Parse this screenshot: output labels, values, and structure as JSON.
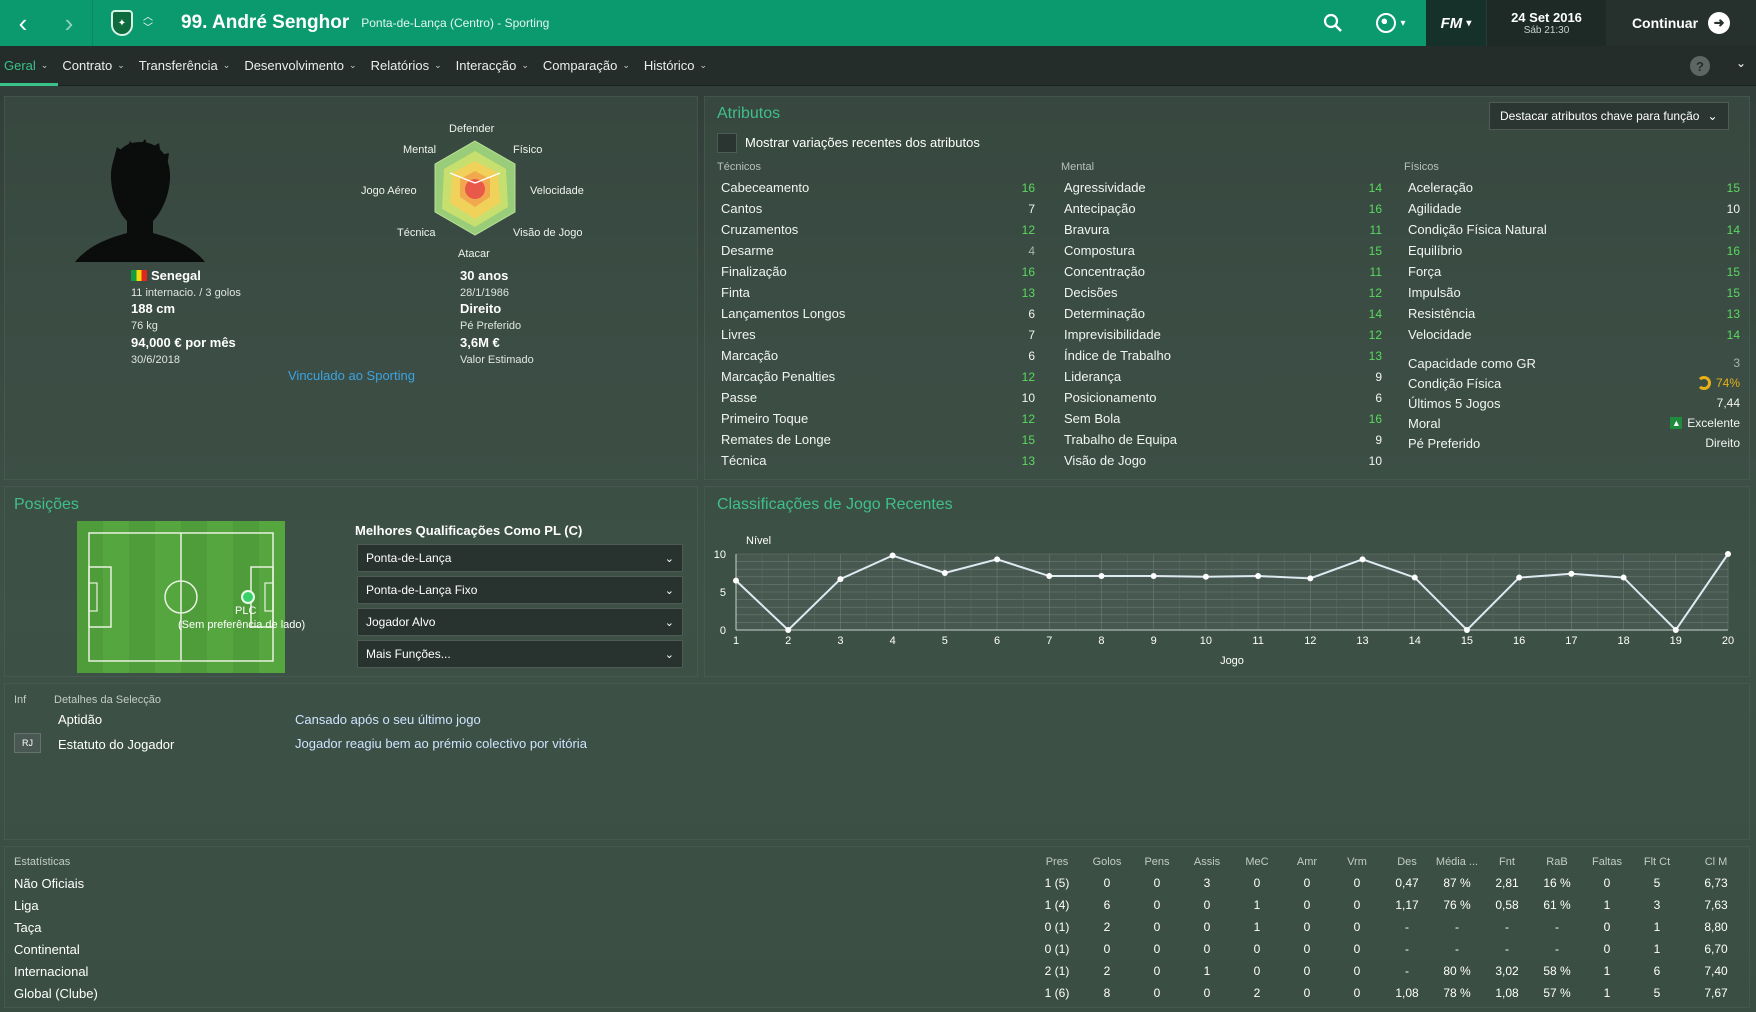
{
  "topbar": {
    "player_title": "99. André Senghor",
    "player_subtitle": "Ponta-de-Lança (Centro) - Sporting",
    "fm_label": "FM",
    "date_line1": "24 Set 2016",
    "date_line2": "Sáb 21:30",
    "continue_label": "Continuar"
  },
  "menu": {
    "items": [
      "Geral",
      "Contrato",
      "Transferência",
      "Desenvolvimento",
      "Relatórios",
      "Interacção",
      "Comparação",
      "Histórico"
    ],
    "active": "Geral",
    "help": "?"
  },
  "profile": {
    "nationality": "Senegal",
    "caps": "11 internacio. / 3 golos",
    "height": "188 cm",
    "weight": "76 kg",
    "wage": "94,000 € por mês",
    "contract_end": "30/6/2018",
    "age": "30 anos",
    "dob": "28/1/1986",
    "foot": "Direito",
    "foot_label": "Pé Preferido",
    "value": "3,6M €",
    "value_label": "Valor Estimado",
    "link": "Vinculado ao Sporting",
    "radar_labels": {
      "defender": "Defender",
      "fisico": "Físico",
      "velocidade": "Velocidade",
      "visao": "Visão de Jogo",
      "atacar": "Atacar",
      "tecnica": "Técnica",
      "jogo_aereo": "Jogo Aéreo",
      "mental": "Mental"
    }
  },
  "attributes": {
    "title": "Atributos",
    "highlight_dropdown": "Destacar atributos chave para função",
    "show_changes": "Mostrar variações recentes dos atributos",
    "tecnicos_label": "Técnicos",
    "mental_label": "Mental",
    "fisicos_label": "Físicos",
    "tecnicos": [
      {
        "name": "Cabeceamento",
        "value": "16",
        "tone": "green"
      },
      {
        "name": "Cantos",
        "value": "7",
        "tone": "white"
      },
      {
        "name": "Cruzamentos",
        "value": "12",
        "tone": "green"
      },
      {
        "name": "Desarme",
        "value": "4",
        "tone": "grey"
      },
      {
        "name": "Finalização",
        "value": "16",
        "tone": "green"
      },
      {
        "name": "Finta",
        "value": "13",
        "tone": "green"
      },
      {
        "name": "Lançamentos Longos",
        "value": "6",
        "tone": "white"
      },
      {
        "name": "Livres",
        "value": "7",
        "tone": "white"
      },
      {
        "name": "Marcação",
        "value": "6",
        "tone": "white"
      },
      {
        "name": "Marcação Penalties",
        "value": "12",
        "tone": "green"
      },
      {
        "name": "Passe",
        "value": "10",
        "tone": "white"
      },
      {
        "name": "Primeiro Toque",
        "value": "12",
        "tone": "green"
      },
      {
        "name": "Remates de Longe",
        "value": "15",
        "tone": "green"
      },
      {
        "name": "Técnica",
        "value": "13",
        "tone": "green"
      }
    ],
    "mental": [
      {
        "name": "Agressividade",
        "value": "14",
        "tone": "green"
      },
      {
        "name": "Antecipação",
        "value": "16",
        "tone": "green"
      },
      {
        "name": "Bravura",
        "value": "11",
        "tone": "green"
      },
      {
        "name": "Compostura",
        "value": "15",
        "tone": "green"
      },
      {
        "name": "Concentração",
        "value": "11",
        "tone": "green"
      },
      {
        "name": "Decisões",
        "value": "12",
        "tone": "green"
      },
      {
        "name": "Determinação",
        "value": "14",
        "tone": "green"
      },
      {
        "name": "Imprevisibilidade",
        "value": "12",
        "tone": "green"
      },
      {
        "name": "Índice de Trabalho",
        "value": "13",
        "tone": "green"
      },
      {
        "name": "Liderança",
        "value": "9",
        "tone": "white"
      },
      {
        "name": "Posicionamento",
        "value": "6",
        "tone": "white"
      },
      {
        "name": "Sem Bola",
        "value": "16",
        "tone": "green"
      },
      {
        "name": "Trabalho de Equipa",
        "value": "9",
        "tone": "white"
      },
      {
        "name": "Visão de Jogo",
        "value": "10",
        "tone": "white"
      }
    ],
    "fisicos": [
      {
        "name": "Aceleração",
        "value": "15",
        "tone": "green"
      },
      {
        "name": "Agilidade",
        "value": "10",
        "tone": "white"
      },
      {
        "name": "Condição Física Natural",
        "value": "14",
        "tone": "green"
      },
      {
        "name": "Equilíbrio",
        "value": "16",
        "tone": "green"
      },
      {
        "name": "Força",
        "value": "15",
        "tone": "green"
      },
      {
        "name": "Impulsão",
        "value": "15",
        "tone": "green"
      },
      {
        "name": "Resistência",
        "value": "13",
        "tone": "green"
      },
      {
        "name": "Velocidade",
        "value": "14",
        "tone": "green"
      }
    ],
    "extras": [
      {
        "name": "Capacidade como GR",
        "value": "3"
      },
      {
        "name": "Condição Física",
        "value": "74%"
      },
      {
        "name": "Últimos 5 Jogos",
        "value": "7,44"
      },
      {
        "name": "Moral",
        "value": "Excelente"
      },
      {
        "name": "Pé Preferido",
        "value": "Direito"
      }
    ]
  },
  "positions": {
    "title": "Posições",
    "position_code": "PLC",
    "position_note": "(Sem preferência de lado)",
    "best_title": "Melhores Qualificações Como PL (C)",
    "roles": [
      "Ponta-de-Lança",
      "Ponta-de-Lança Fixo",
      "Jogador Alvo",
      "Mais Funções..."
    ]
  },
  "recent_ratings": {
    "title": "Classificações de Jogo Recentes"
  },
  "chart_data": {
    "type": "line",
    "title": "Classificações de Jogo Recentes",
    "xlabel": "Jogo",
    "ylabel": "Nível",
    "x": [
      1,
      2,
      3,
      4,
      5,
      6,
      7,
      8,
      9,
      10,
      11,
      12,
      13,
      14,
      15,
      16,
      17,
      18,
      19,
      20
    ],
    "y": [
      6.5,
      0,
      6.7,
      9.8,
      7.5,
      9.3,
      7.1,
      7.1,
      7.1,
      7.0,
      7.1,
      6.8,
      9.3,
      6.9,
      0,
      6.9,
      7.4,
      6.9,
      0,
      10
    ],
    "ylim": [
      0,
      10
    ],
    "yticks": [
      0,
      5,
      10
    ],
    "grid": true,
    "line_color": "#dfe9f2"
  },
  "selection": {
    "inf_header": "Inf",
    "details_header": "Detalhes da Selecção",
    "rows": [
      {
        "label": "Aptidão",
        "value": "Cansado após o seu último jogo",
        "badge": ""
      },
      {
        "label": "Estatuto do Jogador",
        "value": "Jogador reagiu bem ao prémio colectivo por vitória",
        "badge": "RJ"
      }
    ]
  },
  "stats": {
    "headers": [
      "Estatísticas",
      "Pres",
      "Golos",
      "Pens",
      "Assis",
      "MeC",
      "Amr",
      "Vrm",
      "Des",
      "Média ...",
      "Fnt",
      "RaB",
      "Faltas",
      "Flt Ct",
      "Cl M"
    ],
    "rows": [
      [
        "Não Oficiais",
        "1 (5)",
        "0",
        "0",
        "3",
        "0",
        "0",
        "0",
        "0,47",
        "87 %",
        "2,81",
        "16 %",
        "0",
        "5",
        "6,73"
      ],
      [
        "Liga",
        "1 (4)",
        "6",
        "0",
        "0",
        "1",
        "0",
        "0",
        "1,17",
        "76 %",
        "0,58",
        "61 %",
        "1",
        "3",
        "7,63"
      ],
      [
        "Taça",
        "0 (1)",
        "2",
        "0",
        "0",
        "1",
        "0",
        "0",
        "-",
        "-",
        "-",
        "-",
        "0",
        "1",
        "8,80"
      ],
      [
        "Continental",
        "0 (1)",
        "0",
        "0",
        "0",
        "0",
        "0",
        "0",
        "-",
        "-",
        "-",
        "-",
        "0",
        "1",
        "6,70"
      ],
      [
        "Internacional",
        "2 (1)",
        "2",
        "0",
        "1",
        "0",
        "0",
        "0",
        "-",
        "80 %",
        "3,02",
        "58 %",
        "1",
        "6",
        "7,40"
      ],
      [
        "Global (Clube)",
        "1 (6)",
        "8",
        "0",
        "0",
        "2",
        "0",
        "0",
        "1,08",
        "78 %",
        "1,08",
        "57 %",
        "1",
        "5",
        "7,67"
      ]
    ]
  }
}
